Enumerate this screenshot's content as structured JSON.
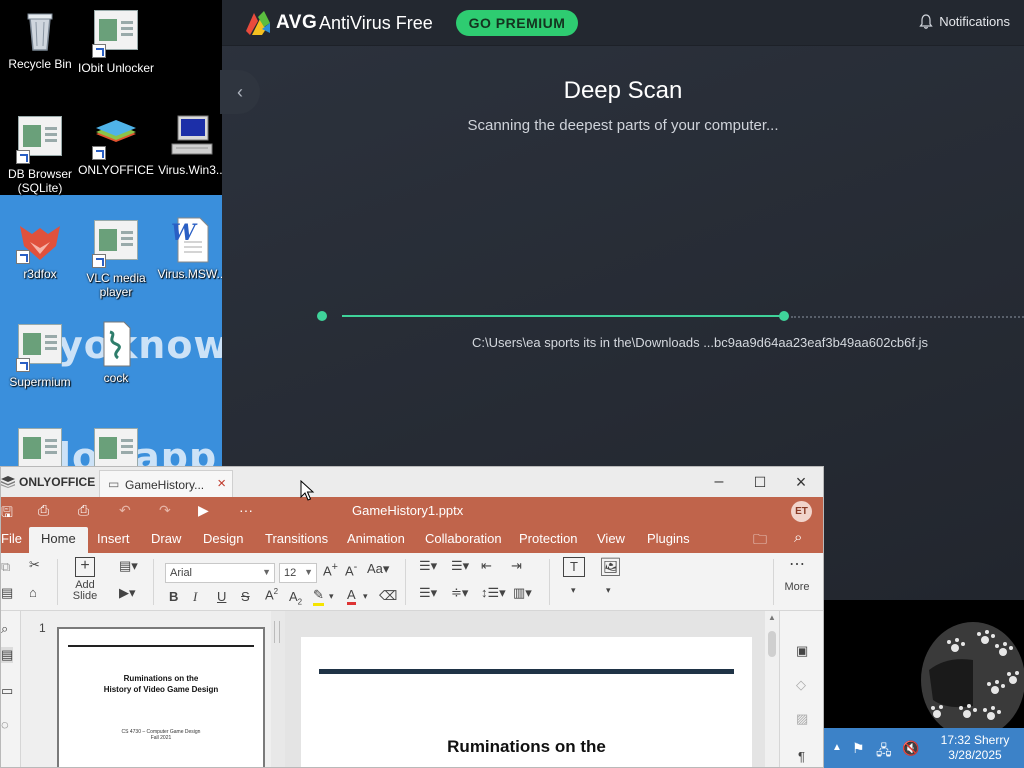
{
  "desktop": {
    "wallpaper_text": [
      "yo",
      "know",
      "lo",
      "tapp"
    ],
    "icons": [
      {
        "label": "Recycle Bin"
      },
      {
        "label": "IObit Unlocker"
      },
      {
        "label": "DB Browser (SQLite)"
      },
      {
        "label": "ONLYOFFICE"
      },
      {
        "label": "Virus.Win3..."
      },
      {
        "label": "r3dfox"
      },
      {
        "label": "VLC media player"
      },
      {
        "label": "Virus.MSW..."
      },
      {
        "label": "Supermium"
      },
      {
        "label": "cock"
      }
    ]
  },
  "avg": {
    "brand": "AVG",
    "product": "AntiVirus Free",
    "go_premium": "GO PREMIUM",
    "notifications": "Notifications",
    "scan_title": "Deep Scan",
    "scan_subtitle": "Scanning the deepest parts of your computer...",
    "scan_path": "C:\\Users\\ea sports its in the\\Downloads ...bc9aa9d64aa23eaf3b49aa602cb6f.js",
    "colors": {
      "accent": "#3fd39a",
      "premium": "#2ecc71",
      "bg": "#282d36"
    }
  },
  "onlyoffice": {
    "app_name": "ONLYOFFICE",
    "tab_title": "GameHistory...",
    "doc_title": "GameHistory1.pptx",
    "avatar": "ET",
    "ribbon_tabs": [
      "File",
      "Home",
      "Insert",
      "Draw",
      "Design",
      "Transitions",
      "Animation",
      "Collaboration",
      "Protection",
      "View",
      "Plugins"
    ],
    "add_slide": "Add Slide",
    "font_name": "Arial",
    "font_size": "12",
    "more": "More",
    "slide_number": "1",
    "thumb_title_line1": "Ruminations on the",
    "thumb_title_line2": "History of Video Game Design",
    "thumb_subtitle_line1": "CS 4730 – Computer Game Design",
    "thumb_subtitle_line2": "Fall 2021",
    "slide_title_line1": "Ruminations on the",
    "colors": {
      "brand": "#c0644b",
      "slide_bar": "#1f3346"
    }
  },
  "taskbar": {
    "time_user": "17:32 Sherry",
    "date": "3/28/2025"
  }
}
